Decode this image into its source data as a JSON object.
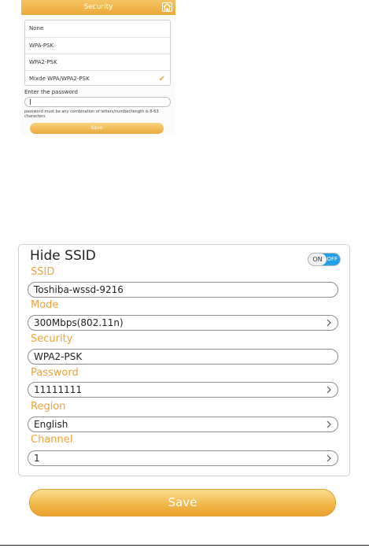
{
  "top_panel": {
    "title": "Security",
    "home_icon": "home-icon",
    "options": [
      "None",
      "WPA-PSK",
      "WPA2-PSK",
      "Mixde WPA/WPA2-PSK"
    ],
    "selected_option": "Mixde WPA/WPA2-PSK",
    "check_glyph": "✔",
    "password_label": "Enter the password",
    "password_value": "",
    "hint": "password must be any combination of letters/number/length is 8-63 characters",
    "save_label": "Save"
  },
  "settings": {
    "hide_ssid": {
      "label": "Hide SSID",
      "toggle_on_label": "ON",
      "toggle_off_label": "OFF"
    },
    "fields": [
      {
        "label": "SSID",
        "value": "Toshiba-wssd-9216",
        "chevron": false
      },
      {
        "label": "Mode",
        "value": "300Mbps(802.11n)",
        "chevron": true
      },
      {
        "label": "Security",
        "value": "WPA2-PSK",
        "chevron": false
      },
      {
        "label": "Password",
        "value": "11111111",
        "chevron": true
      },
      {
        "label": "Region",
        "value": "English",
        "chevron": true
      },
      {
        "label": "Channel",
        "value": "1",
        "chevron": true
      }
    ],
    "save_label": "Save"
  },
  "colors": {
    "accent_orange": "#f0a33a",
    "toggle_blue": "#1ea1e6"
  }
}
